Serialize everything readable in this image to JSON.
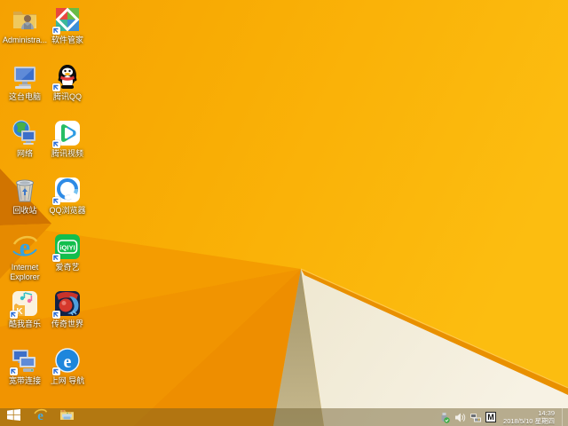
{
  "desktop": {
    "icons": [
      {
        "label": "Administra...",
        "name": "user-folder",
        "shortcut": false
      },
      {
        "label": "软件管家",
        "name": "software-manager",
        "shortcut": true
      },
      {
        "label": "这台电脑",
        "name": "this-pc",
        "shortcut": false
      },
      {
        "label": "腾讯QQ",
        "name": "tencent-qq",
        "shortcut": true
      },
      {
        "label": "网络",
        "name": "network",
        "shortcut": false
      },
      {
        "label": "腾讯视频",
        "name": "tencent-video",
        "shortcut": true
      },
      {
        "label": "回收站",
        "name": "recycle-bin",
        "shortcut": false
      },
      {
        "label": "QQ浏览器",
        "name": "qq-browser",
        "shortcut": true
      },
      {
        "label": "Internet Explorer",
        "name": "internet-explorer",
        "shortcut": false
      },
      {
        "label": "爱奇艺",
        "name": "iqiyi",
        "shortcut": true
      },
      {
        "label": "酷我音乐",
        "name": "kuwo-music",
        "shortcut": true
      },
      {
        "label": "传奇世界",
        "name": "chuanqi-shijie",
        "shortcut": true
      },
      {
        "label": "宽带连接",
        "name": "broadband-connection",
        "shortcut": true
      },
      {
        "label": "上网 导航",
        "name": "web-navigation",
        "shortcut": true
      }
    ]
  },
  "taskbar": {
    "start_button": "start",
    "pinned": [
      "internet-explorer",
      "file-explorer"
    ],
    "tray": {
      "icons": [
        "usb-safely-remove",
        "volume",
        "network-warning",
        "input-method"
      ],
      "ime_label": "M",
      "time": "14:39",
      "date": "2018/5/10 星期四"
    }
  },
  "wallpaper": {
    "style": "windows-8.1-orange-polygon",
    "colors": {
      "base_left": "#F6A202",
      "base_right": "#FCBD10",
      "dark_wedge": "#D17400",
      "fan_shade": "#EE8E00",
      "olive_triangle": "#AFA074",
      "white_triangle": "#F3EDDA",
      "fold_edge": "#E99000",
      "taskbar_tint": "rgba(104,86,38,0.45)"
    }
  }
}
